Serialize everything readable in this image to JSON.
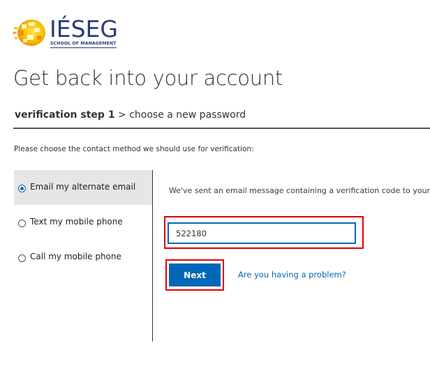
{
  "logo": {
    "name": "IÉSEG",
    "subtitle": "SCHOOL OF MANAGEMENT",
    "colors": {
      "navy": "#2a3a7c",
      "yellow": "#f5c400",
      "orange": "#f08a00"
    }
  },
  "page": {
    "title": "Get back into your account"
  },
  "breadcrumb": {
    "current": "verification step 1",
    "separator": " > ",
    "next": "choose a new password"
  },
  "instruction": "Please choose the contact method we should use for verification:",
  "methods": [
    {
      "label": "Email my alternate email",
      "selected": true
    },
    {
      "label": "Text my mobile phone",
      "selected": false
    },
    {
      "label": "Call my mobile phone",
      "selected": false
    }
  ],
  "verification": {
    "message": "We've sent an email message containing a verification code to your in",
    "code_value": "522180"
  },
  "actions": {
    "next_label": "Next",
    "problem_link": "Are you having a problem?"
  },
  "colors": {
    "accent": "#0067b8",
    "highlight": "#e00000",
    "selected_bg": "#e6e6e6"
  }
}
